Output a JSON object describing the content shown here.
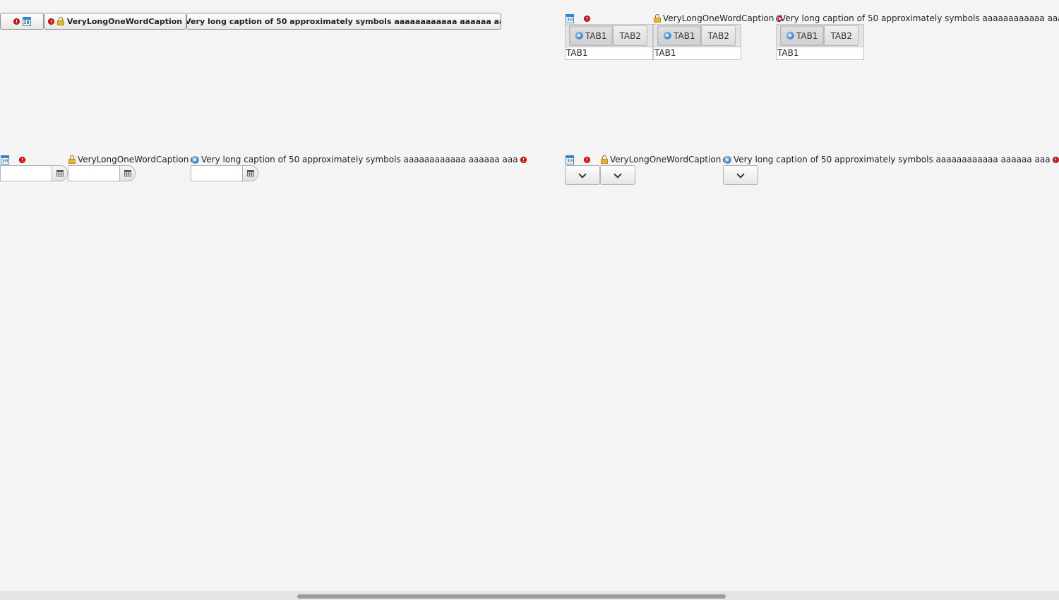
{
  "captions": {
    "long_word": "VeryLongOneWordCaption",
    "long_text": "Very long caption of 50 approximately symbols aaaaaaaaaaaa aaaaaa aaa"
  },
  "icons": {
    "error": "error-indicator-icon",
    "calendar": "calendar-icon",
    "calendar_text": "30",
    "lock": "lock-icon",
    "globe": "globe-icon"
  },
  "tabsheets": {
    "tabs": [
      "TAB1",
      "TAB2"
    ],
    "content": "TAB1"
  },
  "colors": {
    "error": "#d41c1c",
    "background": "#f4f4f4"
  }
}
